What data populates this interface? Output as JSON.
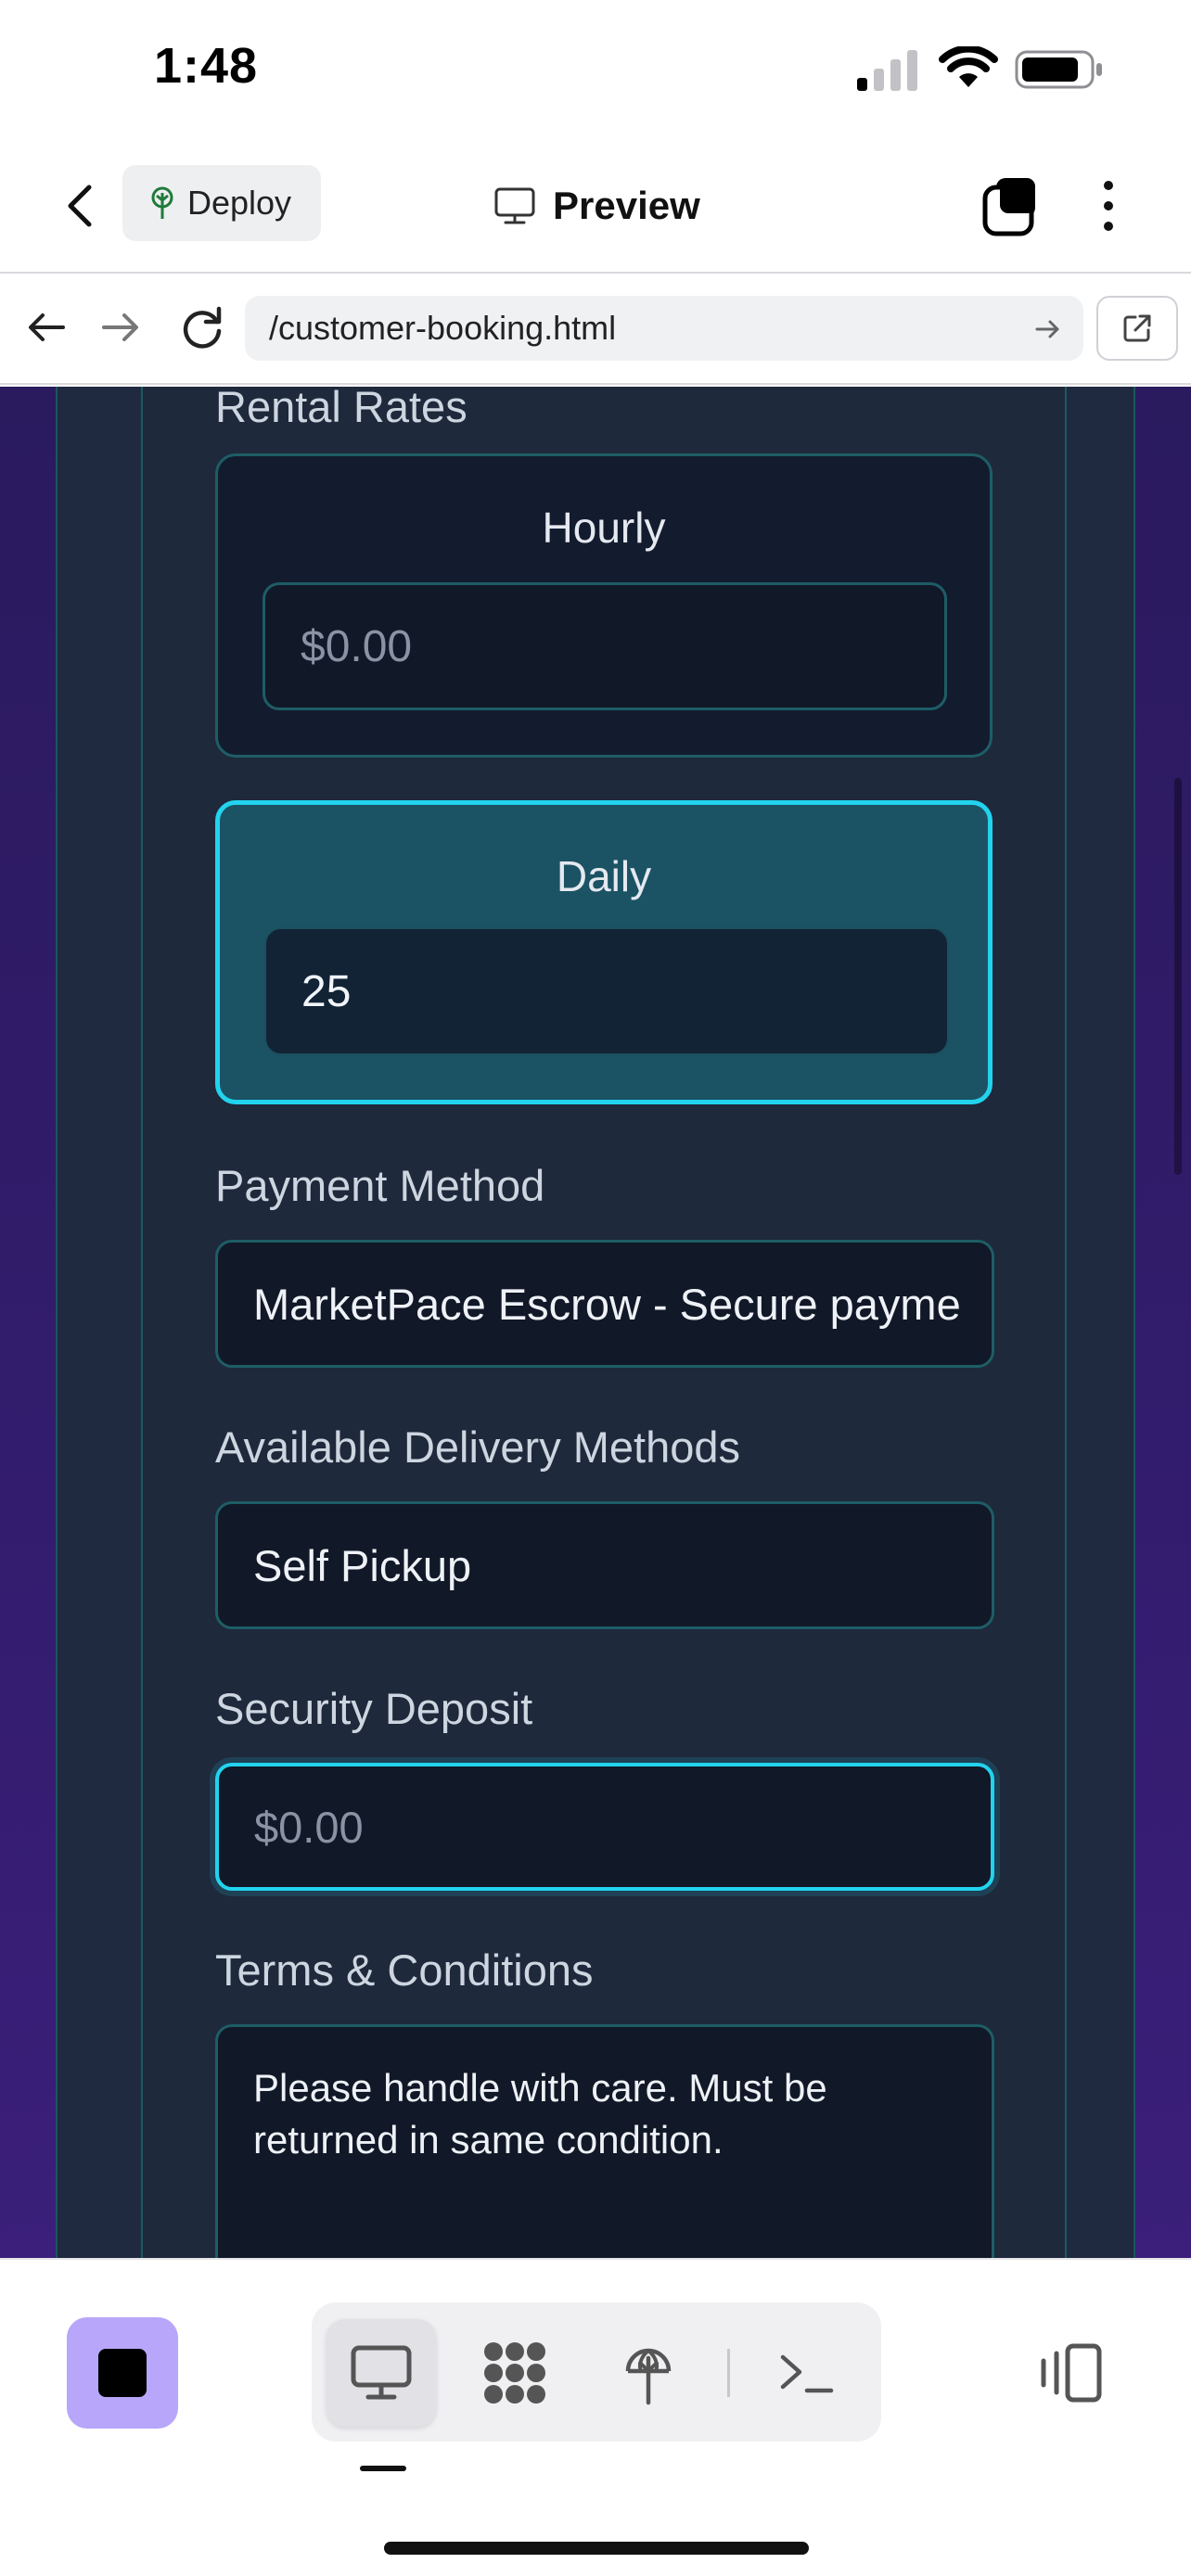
{
  "status_bar": {
    "time": "1:48"
  },
  "app_header": {
    "deploy_label": "Deploy",
    "preview_label": "Preview"
  },
  "browser": {
    "url": "/customer-booking.html"
  },
  "form": {
    "rental_rates_label": "Rental Rates",
    "hourly": {
      "title": "Hourly",
      "placeholder": "$0.00"
    },
    "daily": {
      "title": "Daily",
      "value": "25"
    },
    "payment_method": {
      "label": "Payment Method",
      "value": "MarketPace Escrow - Secure payme"
    },
    "delivery_methods": {
      "label": "Available Delivery Methods",
      "value": "Self Pickup"
    },
    "security_deposit": {
      "label": "Security Deposit",
      "placeholder": "$0.00"
    },
    "terms": {
      "label": "Terms & Conditions",
      "value": "Please handle with care. Must be returned in same condition."
    }
  },
  "colors": {
    "accent": "#22d3ee",
    "stop_button": "#b7a6f9",
    "panel": "#1e293b",
    "background": "#2a1a5e"
  },
  "icons": {
    "header": [
      "chevron-left-icon",
      "sprout-icon",
      "monitor-icon",
      "tabs-icon",
      "kebab-menu-icon"
    ],
    "browser": [
      "arrow-left-icon",
      "arrow-right-icon",
      "reload-icon",
      "arrow-go-icon",
      "external-link-icon"
    ],
    "toolbar": [
      "stop-icon",
      "monitor-icon",
      "apps-grid-icon",
      "deploy-globe-icon",
      "terminal-icon",
      "device-switch-icon"
    ]
  }
}
